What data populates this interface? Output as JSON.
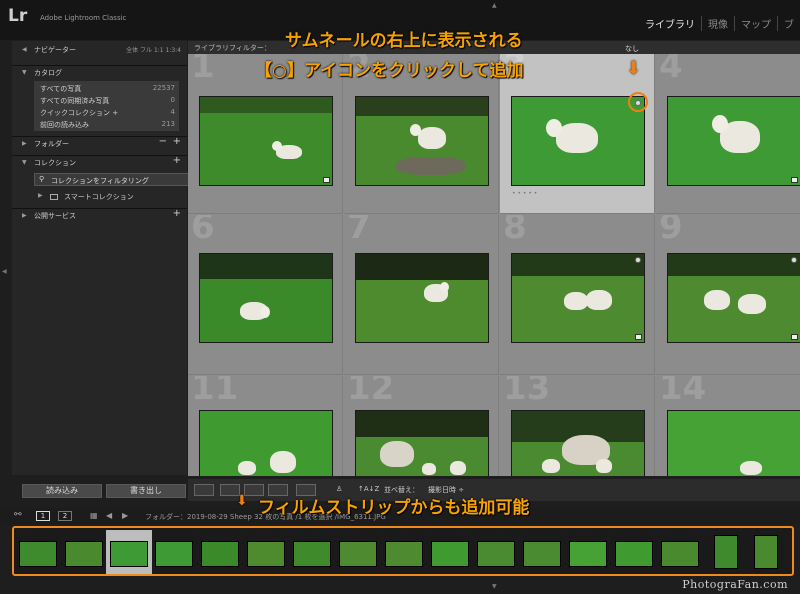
{
  "app": {
    "logo": "Lr",
    "name": "Adobe Lightroom Classic"
  },
  "modules": [
    "ライブラリ",
    "現像",
    "マップ",
    "ブ"
  ],
  "left_panel": {
    "navigator": {
      "label": "ナビゲーター",
      "options": "全体  フル  1:1  1:3:4"
    },
    "catalog": {
      "label": "カタログ",
      "items": [
        {
          "name": "すべての写真",
          "count": "22537"
        },
        {
          "name": "すべての同期済み写真",
          "count": "0"
        },
        {
          "name": "クイックコレクション  +",
          "count": "4"
        },
        {
          "name": "前回の読み込み",
          "count": "213"
        }
      ]
    },
    "folders": {
      "label": "フォルダー"
    },
    "collections": {
      "label": "コレクション",
      "filter": "コレクションをフィルタリング",
      "smart": "スマートコレクション"
    },
    "publish": {
      "label": "公開サービス"
    }
  },
  "buttons": {
    "import": "読み込み",
    "export": "書き出し"
  },
  "grid": {
    "filter_title": "ライブラリフィルター：",
    "filter_none": "なし",
    "cells": [
      {
        "num": "1"
      },
      {
        "num": "2"
      },
      {
        "num": "3"
      },
      {
        "num": "4"
      },
      {
        "num": "6"
      },
      {
        "num": "7"
      },
      {
        "num": "8"
      },
      {
        "num": "9"
      },
      {
        "num": "11"
      },
      {
        "num": "12"
      },
      {
        "num": "13"
      },
      {
        "num": "14"
      }
    ]
  },
  "toolbar": {
    "sort_label": "並べ替え：",
    "sort_value": "撮影日時 ÷"
  },
  "filmstrip": {
    "pages": [
      "1",
      "2"
    ],
    "folder_info": "フォルダー：2019-08-29 Sheep  32 枚の写真 /1 枚を選択 /IMG_6311.JPG"
  },
  "annotations": {
    "line1": "サムネールの右上に表示される",
    "line2": "【○】アイコンをクリックして追加",
    "line3": "フィルムストリップからも追加可能",
    "arrow": "⬇"
  },
  "watermark": "PhotograFan.com",
  "colors": {
    "accent": "#f7a200",
    "ring": "#f07f13",
    "grass": "#3f8a2c"
  }
}
